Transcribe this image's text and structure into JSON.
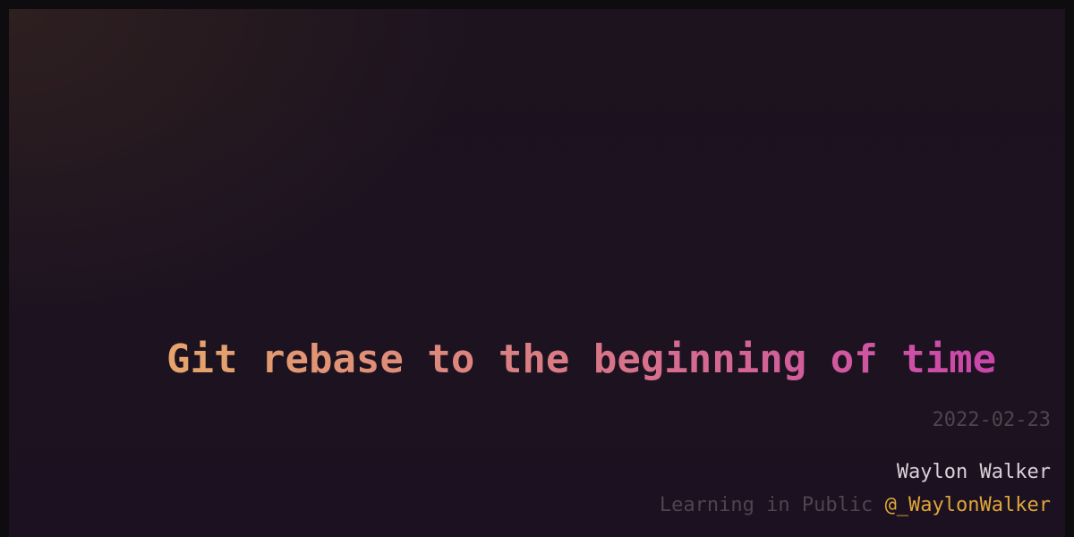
{
  "post": {
    "title": "Git rebase to the beginning of time",
    "date": "2022-02-23"
  },
  "author": {
    "name": "Waylon Walker",
    "tagline_prefix": "Learning in Public",
    "handle": "@_WaylonWalker"
  },
  "colors": {
    "title_gradient_start": "#e6a56a",
    "title_gradient_mid": "#d97a85",
    "title_gradient_end": "#c83fb0",
    "handle": "#e0a63a",
    "muted": "#4e4550",
    "author": "#d6d2d8",
    "background": "#1c1220"
  }
}
